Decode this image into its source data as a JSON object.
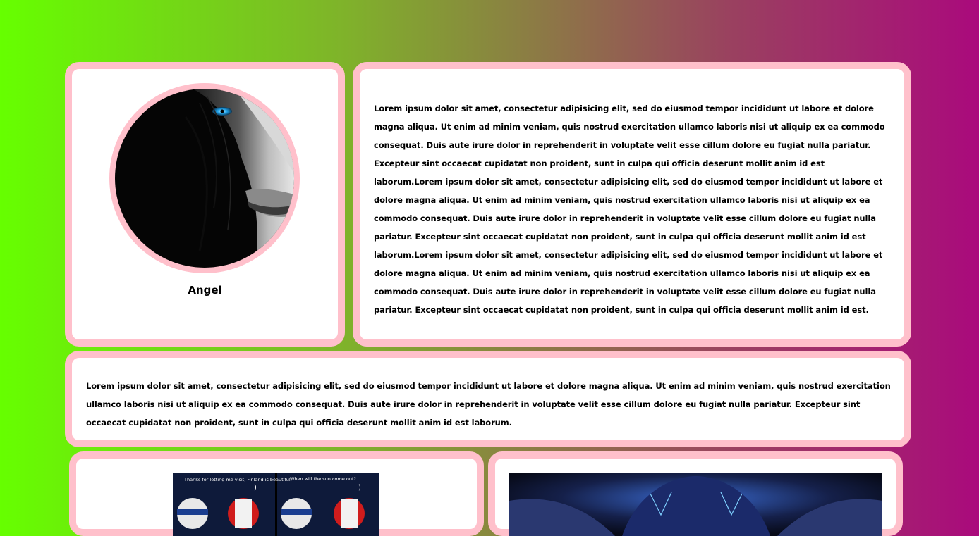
{
  "profile": {
    "name": "Angel",
    "avatar": "woman-face-portrait-blue-eye"
  },
  "bio": {
    "text": "Lorem ipsum dolor sit amet, consectetur adipisicing elit, sed do eiusmod tempor incididunt ut labore et dolore magna aliqua. Ut enim ad minim veniam, quis nostrud exercitation ullamco laboris nisi ut aliquip ex ea commodo consequat. Duis aute irure dolor in reprehenderit in voluptate velit esse cillum dolore eu fugiat nulla pariatur. Excepteur sint occaecat cupidatat non proident, sunt in culpa qui officia deserunt mollit anim id est laborum.Lorem ipsum dolor sit amet, consectetur adipisicing elit, sed do eiusmod tempor incididunt ut labore et dolore magna aliqua. Ut enim ad minim veniam, quis nostrud exercitation ullamco laboris nisi ut aliquip ex ea commodo consequat. Duis aute irure dolor in reprehenderit in voluptate velit esse cillum dolore eu fugiat nulla pariatur. Excepteur sint occaecat cupidatat non proident, sunt in culpa qui officia deserunt mollit anim id est laborum.Lorem ipsum dolor sit amet, consectetur adipisicing elit, sed do eiusmod tempor incididunt ut labore et dolore magna aliqua. Ut enim ad minim veniam, quis nostrud exercitation ullamco laboris nisi ut aliquip ex ea commodo consequat. Duis aute irure dolor in reprehenderit in voluptate velit esse cillum dolore eu fugiat nulla pariatur. Excepteur sint occaecat cupidatat non proident, sunt in culpa qui officia deserunt mollit anim id est."
  },
  "wide": {
    "text": "Lorem ipsum dolor sit amet, consectetur adipisicing elit, sed do eiusmod tempor incididunt ut labore et dolore magna aliqua. Ut enim ad minim veniam, quis nostrud exercitation ullamco laboris nisi ut aliquip ex ea commodo consequat. Duis aute irure dolor in reprehenderit in voluptate velit esse cillum dolore eu fugiat nulla pariatur. Excepteur sint occaecat cupidatat non proident, sunt in culpa qui officia deserunt mollit anim id est laborum."
  },
  "gallery": {
    "comic_caption_left": "Thanks for letting me visit, Finland is beautiful.",
    "comic_caption_right": "When will the sun come out?"
  },
  "colors": {
    "card_border": "#ffc0cb",
    "gradient_start": "#66ff00",
    "gradient_end": "#aa0a7c"
  }
}
